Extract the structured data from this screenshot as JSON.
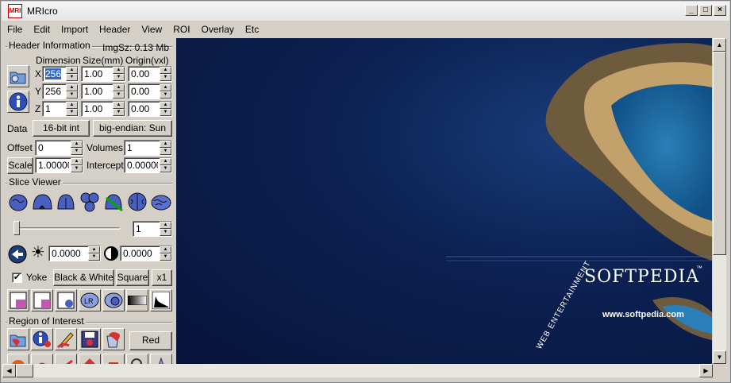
{
  "window": {
    "title": "MRIcro",
    "app_icon_text": "MRI",
    "minimize": "_",
    "maximize": "□",
    "close": "×"
  },
  "menu": [
    "File",
    "Edit",
    "Import",
    "Header",
    "View",
    "ROI",
    "Overlay",
    "Etc"
  ],
  "header_info": {
    "group_title": "Header Information",
    "img_size": "ImgSz: 0.13 Mb",
    "col_dimension": "Dimension",
    "col_size": "Size(mm)",
    "col_origin": "Origin(vxl)",
    "rows": [
      {
        "axis": "X",
        "dimension": "256",
        "size": "1.00",
        "origin": "0.00"
      },
      {
        "axis": "Y",
        "dimension": "256",
        "size": "1.00",
        "origin": "0.00"
      },
      {
        "axis": "Z",
        "dimension": "1",
        "size": "1.00",
        "origin": "0.00"
      }
    ],
    "data_label": "Data",
    "data_type": "16-bit int",
    "endian": "big-endian: Sun",
    "offset_label": "Offset",
    "offset": "0",
    "volumes_label": "Volumes",
    "volumes": "1",
    "scale_label": "Scale",
    "scale": "1.000000",
    "intercept_label": "Intercept",
    "intercept": "0.000000"
  },
  "slice_viewer": {
    "group_title": "Slice Viewer",
    "slice": "1",
    "brightness": "0.0000",
    "contrast": "0.0000",
    "yoke_label": "Yoke",
    "yoke_checked": "✔",
    "bw_button": "Black & White",
    "square_button": "Square",
    "zoom_button": "x1"
  },
  "roi": {
    "group_title": "Region of Interest",
    "color_button": "Red"
  },
  "image": {
    "logo": "SOFTPEDIA",
    "trademark": "™",
    "url": "www.softpedia.com",
    "side_text": "WEB   ENTERTAINMENT"
  },
  "colors": {
    "chrome": "#d4d0c8",
    "selection": "#316ac5",
    "image_bg": "#0c2254",
    "brain_icon": "#4a5fc2"
  }
}
